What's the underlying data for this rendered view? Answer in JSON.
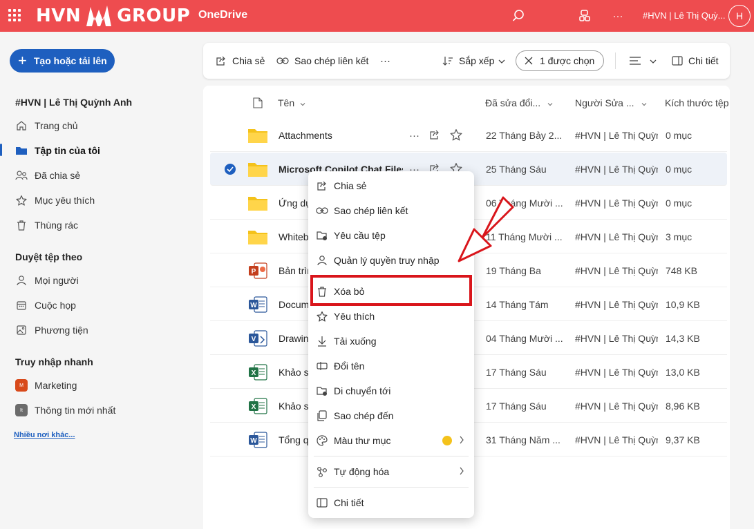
{
  "header": {
    "logo_left": "HVN",
    "logo_right": "GROUP",
    "app_name": "OneDrive",
    "account_name": "#HVN | Lê Thị Quỳ...",
    "avatar_initial": "H",
    "more_label": "···",
    "brand_color": "#ee4c4f"
  },
  "sidebar": {
    "create_label": "Tạo hoặc tải lên",
    "user_heading": "#HVN | Lê Thị Quỳnh Anh",
    "nav": [
      {
        "label": "Trang chủ",
        "icon": "home-icon"
      },
      {
        "label": "Tập tin của tôi",
        "icon": "folder-icon",
        "active": true
      },
      {
        "label": "Đã chia sẻ",
        "icon": "people-icon"
      },
      {
        "label": "Mục yêu thích",
        "icon": "star-icon"
      },
      {
        "label": "Thùng rác",
        "icon": "trash-icon"
      }
    ],
    "browse_heading": "Duyệt tệp theo",
    "browse": [
      {
        "label": "Mọi người",
        "icon": "person-icon"
      },
      {
        "label": "Cuộc họp",
        "icon": "calendar-icon"
      },
      {
        "label": "Phương tiện",
        "icon": "image-icon"
      }
    ],
    "quick_heading": "Truy nhập nhanh",
    "quick": [
      {
        "label": "Marketing",
        "badge": "M",
        "color": "#d84a1b"
      },
      {
        "label": "Thông tin mới nhất",
        "badge": "It",
        "color": "#6b6b6b"
      }
    ],
    "more_link": "Nhiều nơi khác..."
  },
  "commandbar": {
    "share": "Chia sẻ",
    "copy_link": "Sao chép liên kết",
    "more": "···",
    "sort": "Sắp xếp",
    "selected": "1 được chọn",
    "details": "Chi tiết"
  },
  "table": {
    "columns": [
      "Tên",
      "Đã sửa đổi...",
      "Người Sửa ...",
      "Kích thước tệp"
    ],
    "rows": [
      {
        "name": "Attachments",
        "type": "folder",
        "modified": "22 Tháng Bảy 2...",
        "by": "#HVN | Lê Thị Quỳnh Anh",
        "size": "0 mục",
        "selected": false
      },
      {
        "name": "Microsoft Copilot Chat Files",
        "type": "folder",
        "modified": "25 Tháng Sáu",
        "by": "#HVN | Lê Thị Quỳnh Anh",
        "size": "0 mục",
        "selected": true
      },
      {
        "name": "Ứng dụng",
        "type": "folder",
        "modified": "06 Tháng Mười ...",
        "by": "#HVN | Lê Thị Quỳnh Anh",
        "size": "0 mục",
        "selected": false
      },
      {
        "name": "Whiteboards",
        "type": "folder",
        "modified": "11 Tháng Mười ...",
        "by": "#HVN | Lê Thị Quỳnh Anh",
        "size": "3 mục",
        "selected": false
      },
      {
        "name": "Bản trình bày",
        "type": "ppt",
        "modified": "19 Tháng Ba",
        "by": "#HVN | Lê Thị Quỳnh Anh",
        "size": "748 KB",
        "selected": false
      },
      {
        "name": "Document",
        "type": "word",
        "modified": "14 Tháng Tám",
        "by": "#HVN | Lê Thị Quỳnh Anh",
        "size": "10,9 KB",
        "selected": false
      },
      {
        "name": "Drawing",
        "type": "visio",
        "modified": "04 Tháng Mười ...",
        "by": "#HVN | Lê Thị Quỳnh Anh",
        "size": "14,3 KB",
        "selected": false
      },
      {
        "name": "Khảo sát",
        "type": "excel",
        "modified": "17 Tháng Sáu",
        "by": "#HVN | Lê Thị Quỳnh Anh",
        "size": "13,0 KB",
        "selected": false
      },
      {
        "name": "Khảo sát",
        "type": "excel",
        "modified": "17 Tháng Sáu",
        "by": "#HVN | Lê Thị Quỳnh Anh",
        "size": "8,96 KB",
        "selected": false
      },
      {
        "name": "Tổng quan",
        "type": "word",
        "modified": "31 Tháng Năm ...",
        "by": "#HVN | Lê Thị Quỳnh Anh",
        "size": "9,37 KB",
        "selected": false
      }
    ],
    "row_more": "···"
  },
  "context_menu": {
    "items": [
      {
        "label": "Chia sẻ",
        "icon": "share-icon"
      },
      {
        "label": "Sao chép liên kết",
        "icon": "link-icon"
      },
      {
        "label": "Yêu cầu tệp",
        "icon": "request-files-icon"
      },
      {
        "label": "Quản lý quyền truy nhập",
        "icon": "person-icon"
      },
      {
        "label": "Xóa bỏ",
        "icon": "trash-icon"
      },
      {
        "label": "Yêu thích",
        "icon": "star-icon"
      },
      {
        "label": "Tải xuống",
        "icon": "download-icon"
      },
      {
        "label": "Đổi tên",
        "icon": "rename-icon"
      },
      {
        "label": "Di chuyển tới",
        "icon": "move-icon"
      },
      {
        "label": "Sao chép đến",
        "icon": "copy-icon"
      },
      {
        "label": "Màu thư mục",
        "icon": "palette-icon"
      },
      {
        "label": "Tự động hóa",
        "icon": "automate-icon"
      },
      {
        "label": "Chi tiết",
        "icon": "details-icon"
      }
    ],
    "folder_color": "#f4c21b",
    "highlight_color": "#d9151b"
  }
}
